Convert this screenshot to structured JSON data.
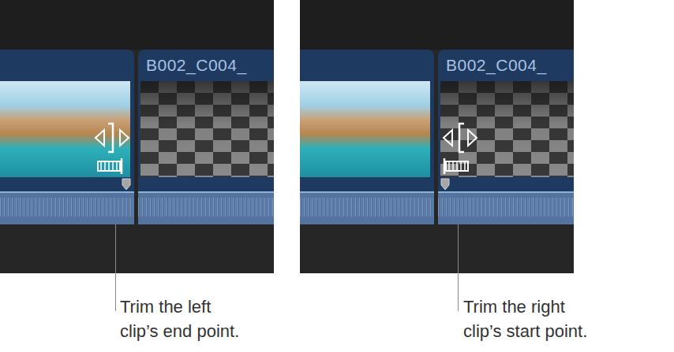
{
  "panels": [
    {
      "clips": [
        {
          "kind": "photo"
        },
        {
          "kind": "checker",
          "title": "B002_C004_"
        }
      ],
      "trim": {
        "clip": 0,
        "edge": "end"
      },
      "caption": [
        "Trim the left",
        "clip’s end point."
      ]
    },
    {
      "clips": [
        {
          "kind": "photo"
        },
        {
          "kind": "checker",
          "title": "B002_C004_"
        }
      ],
      "trim": {
        "clip": 1,
        "edge": "start"
      },
      "caption": [
        "Trim the right",
        "clip’s start point."
      ]
    }
  ]
}
